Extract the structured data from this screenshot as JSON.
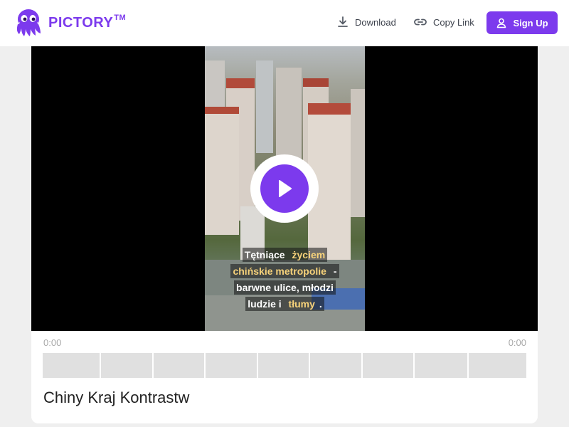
{
  "header": {
    "brand": "PICTORY",
    "brand_tm": "TM",
    "download_label": "Download",
    "copy_link_label": "Copy Link",
    "signup_label": "Sign Up",
    "accent_color": "#7c3aed"
  },
  "icons": {
    "logo": "octopus-logo-icon",
    "download": "download-icon",
    "copy_link": "link-icon",
    "signup": "user-icon",
    "play": "play-icon"
  },
  "player": {
    "caption_lines": [
      [
        {
          "text": "Tętniące ",
          "hl": false
        },
        {
          "text": "życiem",
          "hl": true
        }
      ],
      [
        {
          "text": "chińskie metropolie",
          "hl": true
        },
        {
          "text": " -",
          "hl": false
        }
      ],
      [
        {
          "text": "barwne ulice, młodzi",
          "hl": false
        }
      ],
      [
        {
          "text": "ludzie i ",
          "hl": false
        },
        {
          "text": "tłumy",
          "hl": true
        },
        {
          "text": ".",
          "hl": false
        }
      ]
    ],
    "current_time": "0:00",
    "duration": "0:00",
    "timeline_segments": 9
  },
  "video": {
    "title": "Chiny Kraj Kontrastw"
  }
}
